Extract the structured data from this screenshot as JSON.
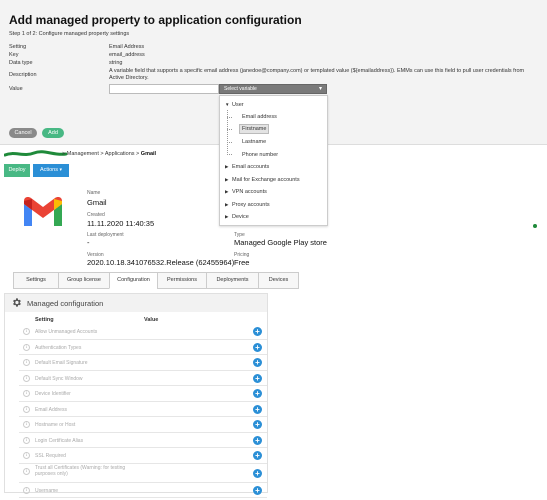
{
  "dialog": {
    "title": "Add managed property to application configuration",
    "step": "Step 1 of 2: Configure managed property settings",
    "setting_label": "Setting",
    "setting_value": "Email Address",
    "key_label": "Key",
    "key_value": "email_address",
    "datatype_label": "Data type",
    "datatype_value": "string",
    "description_label": "Description",
    "description_value": "A variable field that supports a specific email address (janedoe@company.com) or templated value (${emailaddress}). EMMs can use this field to pull user credentials from Active Directory.",
    "value_label": "Value",
    "value_input": "",
    "select_placeholder": "Select variable",
    "cancel_label": "Cancel",
    "add_label": "Add"
  },
  "dropdown": {
    "user_label": "User",
    "user_children": [
      "Email address",
      "Firstname",
      "Lastname",
      "Phone number"
    ],
    "highlighted": "Firstname",
    "groups": [
      "Email accounts",
      "Mail for Exchange accounts",
      "VPN accounts",
      "Proxy accounts",
      "Device"
    ]
  },
  "breadcrumb": {
    "management": "Management",
    "applications": "Applications",
    "current": "Gmail",
    "separator": ">"
  },
  "toolbar": {
    "deploy_label": "Deploy",
    "actions_label": "Actions"
  },
  "app": {
    "name_label": "Name",
    "name_value": "Gmail",
    "created_label": "Created",
    "created_value": "11.11.2020 11:40:35",
    "last_deployment_label": "Last deployment",
    "last_deployment_value": "-",
    "version_label": "Version",
    "version_value": "2020.10.18.341076532.Release (62455964)",
    "type_label": "Type",
    "type_value": "Managed Google Play store",
    "pricing_label": "Pricing",
    "pricing_value": "Free"
  },
  "tabs": [
    "Settings",
    "Group license",
    "Configuration",
    "Permissions",
    "Deployments",
    "Devices"
  ],
  "active_tab": "Configuration",
  "managed_config": {
    "title": "Managed configuration",
    "col_setting": "Setting",
    "col_value": "Value",
    "rows": [
      "Allow Unmanaged Accounts",
      "Authentication Types",
      "Default Email Signature",
      "Default Sync Window",
      "Device Identifier",
      "Email Address",
      "Hostname or Host",
      "Login Certificate Alias",
      "SSL Required",
      "Trust all Certificates (Warning: for testing purposes only)",
      "Username"
    ]
  },
  "colors": {
    "accent_green": "#48b884",
    "accent_blue": "#2b8fd6"
  }
}
